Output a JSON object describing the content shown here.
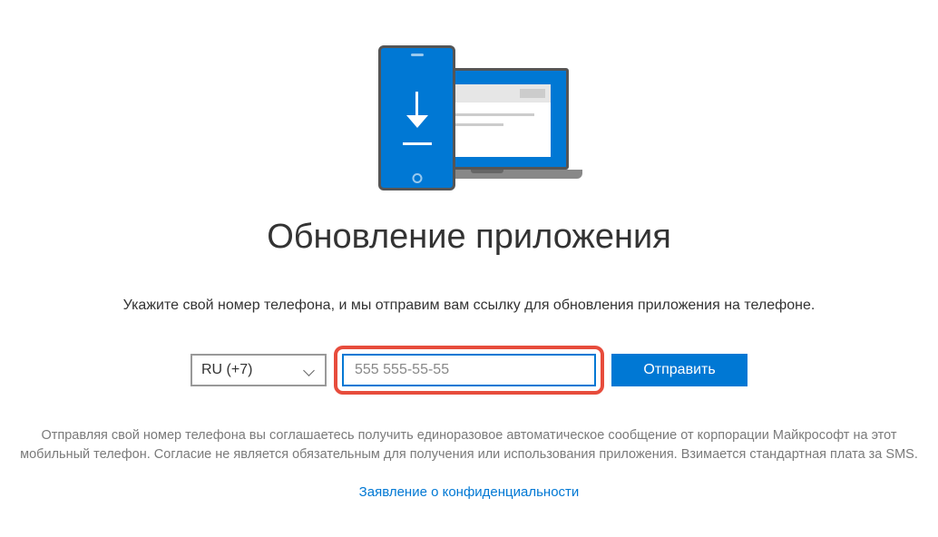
{
  "title": "Обновление приложения",
  "instruction": "Укажите свой номер телефона, и мы отправим вам ссылку для обновления приложения на телефоне.",
  "form": {
    "country_code": "RU (+7)",
    "phone_placeholder": "555 555-55-55",
    "submit_label": "Отправить"
  },
  "disclaimer": "Отправляя свой номер телефона вы соглашаетесь получить единоразовое автоматическое сообщение от корпорации Майкрософт на этот мобильный телефон. Согласие не является обязательным для получения или использования приложения. Взимается стандартная плата за SMS.",
  "privacy_link": "Заявление о конфиденциальности"
}
